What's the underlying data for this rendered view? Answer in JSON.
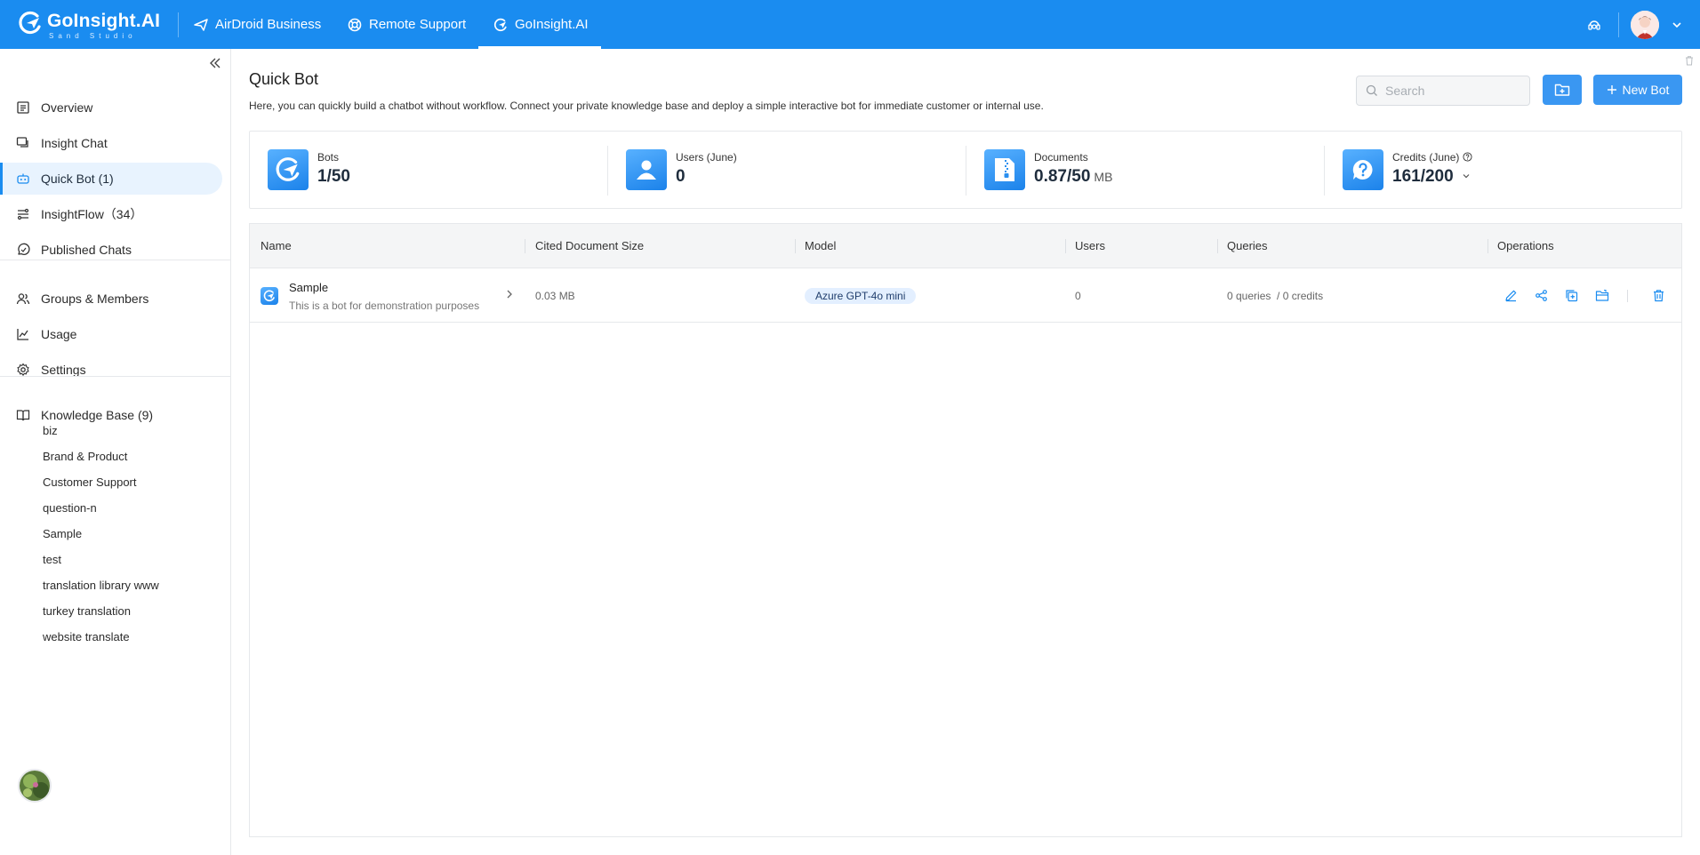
{
  "topbar": {
    "logo_title": "GoInsight.AI",
    "logo_sub": "Sand Studio",
    "nav": [
      {
        "label": "AirDroid Business",
        "icon": "paper-plane-icon"
      },
      {
        "label": "Remote Support",
        "icon": "lifebuoy-icon"
      },
      {
        "label": "GoInsight.AI",
        "icon": "goinsight-icon"
      }
    ],
    "active_nav": "GoInsight.AI",
    "accent": "#1a8cf0"
  },
  "sidebar": {
    "items": [
      {
        "label": "Overview",
        "icon": "document-icon"
      },
      {
        "label": "Insight Chat",
        "icon": "chat-icon"
      },
      {
        "label": "Quick Bot (1)",
        "icon": "robot-icon"
      },
      {
        "label": "InsightFlow（34）",
        "icon": "flow-icon"
      },
      {
        "label": "Published Chats",
        "icon": "published-chat-icon"
      }
    ],
    "items2": [
      {
        "label": "Groups & Members",
        "icon": "users-icon"
      },
      {
        "label": "Usage",
        "icon": "chart-icon"
      },
      {
        "label": "Settings",
        "icon": "gear-icon"
      }
    ],
    "knowledge_base": {
      "label": "Knowledge Base (9)",
      "icon": "book-icon"
    },
    "kb_items": [
      "biz",
      "Brand & Product",
      "Customer Support",
      "question-n",
      "Sample",
      "test",
      "translation library www",
      "turkey translation",
      "website translate"
    ]
  },
  "main": {
    "title": "Quick Bot",
    "description": "Here, you can quickly build a chatbot without workflow. Connect your private knowledge base and deploy a simple interactive bot for immediate customer or internal use.",
    "search_placeholder": "Search",
    "new_bot_label": "New Bot",
    "stats": [
      {
        "label": "Bots",
        "value": "1/50",
        "unit": ""
      },
      {
        "label": "Users (June)",
        "value": "0",
        "unit": ""
      },
      {
        "label": "Documents",
        "value": "0.87/50",
        "unit": "MB"
      },
      {
        "label": "Credits (June)",
        "value": "161/200",
        "unit": ""
      }
    ],
    "table": {
      "columns": [
        "Name",
        "Cited Document Size",
        "Model",
        "Users",
        "Queries",
        "Operations"
      ],
      "rows": [
        {
          "name": "Sample",
          "description": "This is a bot for demonstration purposes",
          "doc_size": "0.03 MB",
          "model": "Azure GPT-4o mini",
          "users": "0",
          "queries": "0 queries",
          "credits": "/ 0 credits"
        }
      ]
    }
  }
}
